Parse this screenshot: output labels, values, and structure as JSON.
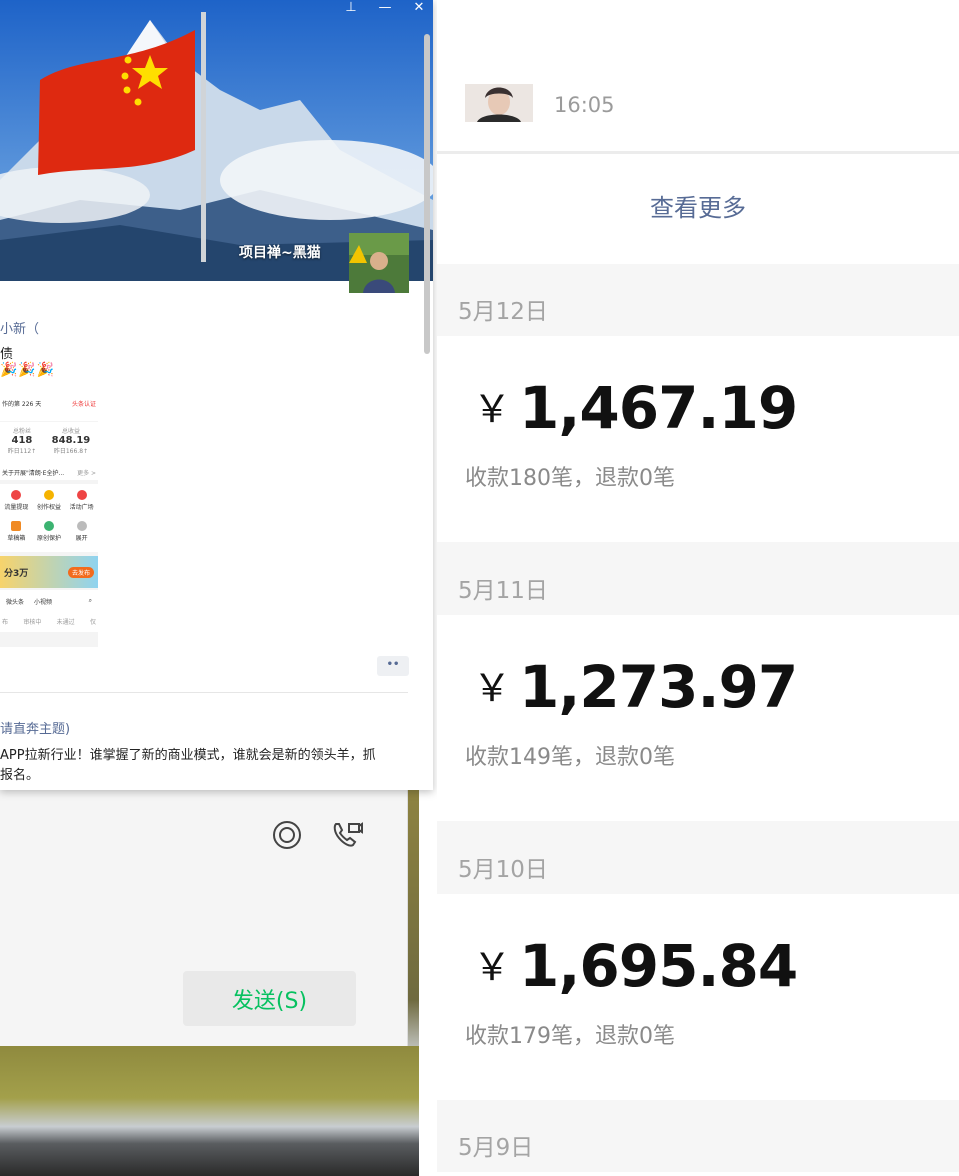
{
  "moments": {
    "window_controls": {
      "pin": "⊥",
      "minimize": "—",
      "close": "✕"
    },
    "cover_name": "项目禅~黑猫",
    "post": {
      "author": "小新（",
      "line1": "债",
      "emojis": "🎉🎉🎉",
      "screenshot": {
        "header_left": "作的第 226 天",
        "header_right": "头条认证",
        "stat1": "418",
        "stat1_sub": "昨日112↑",
        "stat2": "848.19",
        "stat2_sub": "昨日166.8↑",
        "stat2_label": "总收益",
        "stat1_label": "总粉丝",
        "notice": "关于开展\"清朗·E全护...",
        "notice_more": "更多 >",
        "grid": [
          "流量提现",
          "创作权益",
          "活动广场",
          "草稿箱",
          "原创保护",
          "展开"
        ],
        "banner": "分3万",
        "banner_btn": "去发布",
        "tabs": [
          "微头条",
          "小视频"
        ],
        "filters": [
          "布",
          "审核中",
          "未通过",
          "仅"
        ]
      }
    },
    "more_dots": "••",
    "post2": {
      "title": "请直奔主题)",
      "line1": "APP拉新行业！谁掌握了新的商业模式，谁就会是新的领头羊，抓",
      "line2": "报名。"
    }
  },
  "chat": {
    "send_label": "发送(S)"
  },
  "payments": {
    "top_time": "16:05",
    "view_more": "查看更多",
    "days": [
      {
        "date": "5月12日",
        "currency": "￥",
        "amount": "1,467.19",
        "summary": "收款180笔，退款0笔"
      },
      {
        "date": "5月11日",
        "currency": "￥",
        "amount": "1,273.97",
        "summary": "收款149笔，退款0笔"
      },
      {
        "date": "5月10日",
        "currency": "￥",
        "amount": "1,695.84",
        "summary": "收款179笔，退款0笔"
      },
      {
        "date": "5月9日"
      }
    ]
  },
  "colors": {
    "link": "#576b95",
    "send_text": "#07c160",
    "muted": "#a4a4a4"
  }
}
